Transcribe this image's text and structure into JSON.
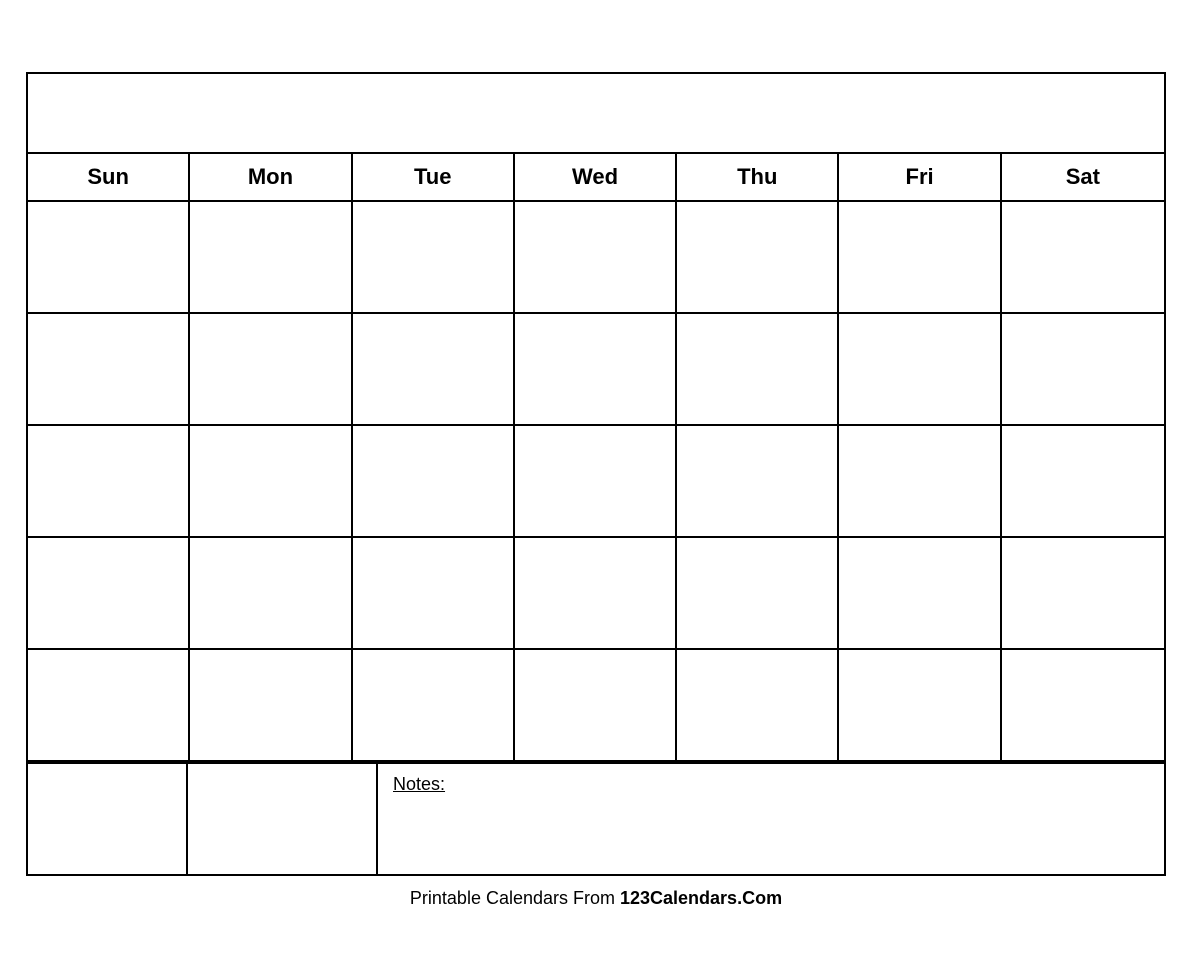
{
  "calendar": {
    "title": "",
    "days": {
      "sun": "Sun",
      "mon": "Mon",
      "tue": "Tue",
      "wed": "Wed",
      "thu": "Thu",
      "fri": "Fri",
      "sat": "Sat"
    },
    "notes_label": "Notes:",
    "weeks": [
      [
        "",
        "",
        "",
        "",
        "",
        "",
        ""
      ],
      [
        "",
        "",
        "",
        "",
        "",
        "",
        ""
      ],
      [
        "",
        "",
        "",
        "",
        "",
        "",
        ""
      ],
      [
        "",
        "",
        "",
        "",
        "",
        "",
        ""
      ],
      [
        "",
        "",
        "",
        "",
        "",
        "",
        ""
      ]
    ]
  },
  "footer": {
    "text": "Printable Calendars From ",
    "brand": "123Calendars.Com"
  }
}
